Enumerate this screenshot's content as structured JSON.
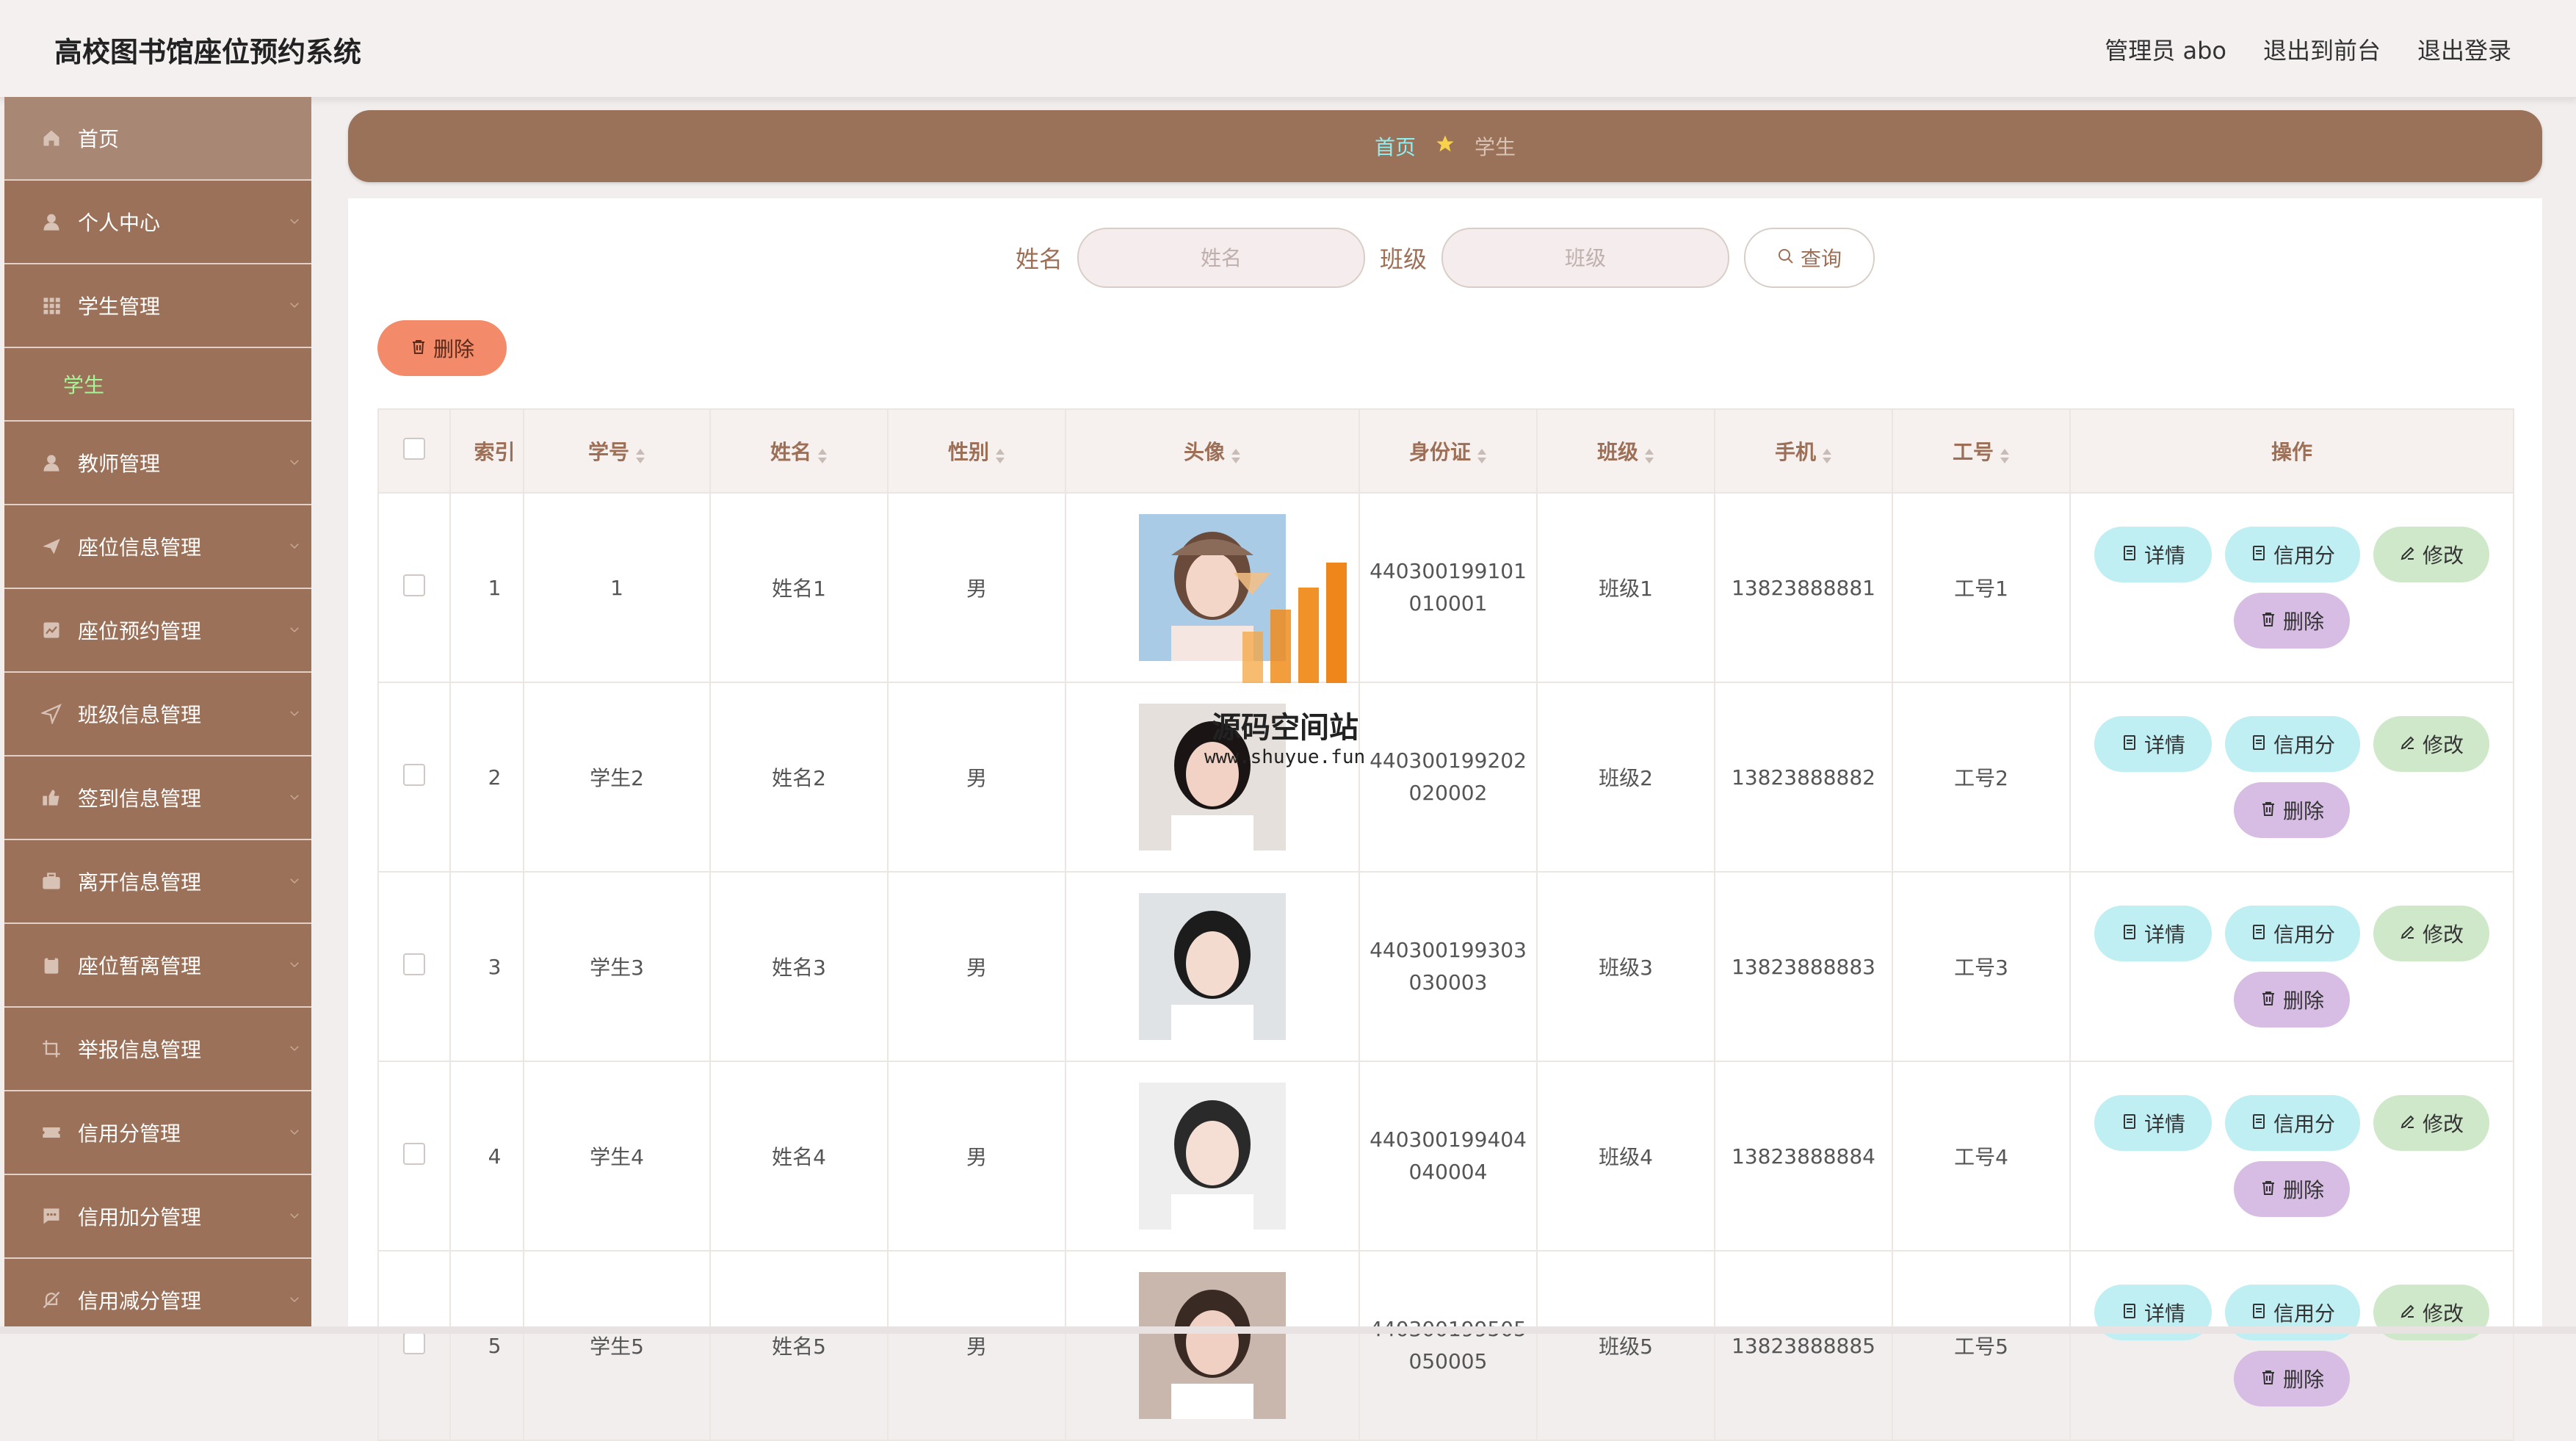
{
  "header": {
    "title": "高校图书馆座位预约系统",
    "admin": "管理员 abo",
    "exit_front": "退出到前台",
    "logout": "退出登录"
  },
  "sidebar": {
    "items": [
      {
        "label": "首页",
        "icon": "home-icon"
      },
      {
        "label": "个人中心",
        "icon": "user-icon"
      },
      {
        "label": "学生管理",
        "icon": "grid-icon",
        "sub": "学生"
      },
      {
        "label": "教师管理",
        "icon": "user-icon"
      },
      {
        "label": "座位信息管理",
        "icon": "send-icon"
      },
      {
        "label": "座位预约管理",
        "icon": "chart-icon"
      },
      {
        "label": "班级信息管理",
        "icon": "paper-plane-icon"
      },
      {
        "label": "签到信息管理",
        "icon": "thumb-icon"
      },
      {
        "label": "离开信息管理",
        "icon": "suitcase-icon"
      },
      {
        "label": "座位暂离管理",
        "icon": "clipboard-icon"
      },
      {
        "label": "举报信息管理",
        "icon": "crop-icon"
      },
      {
        "label": "信用分管理",
        "icon": "ticket-icon"
      },
      {
        "label": "信用加分管理",
        "icon": "message-icon"
      },
      {
        "label": "信用减分管理",
        "icon": "bell-off-icon"
      }
    ]
  },
  "breadcrumb": {
    "home": "首页",
    "current": "学生"
  },
  "search": {
    "name_label": "姓名",
    "name_placeholder": "姓名",
    "class_label": "班级",
    "class_placeholder": "班级",
    "query": "查询"
  },
  "actions": {
    "delete": "删除"
  },
  "table": {
    "headers": [
      "索引",
      "学号",
      "姓名",
      "性别",
      "头像",
      "身份证",
      "班级",
      "手机",
      "工号",
      "操作"
    ],
    "rows": [
      {
        "index": "1",
        "student_no": "1",
        "name": "姓名1",
        "gender": "男",
        "id_a": "440300199101",
        "id_b": "010001",
        "class": "班级1",
        "phone": "13823888881",
        "job_no": "工号1"
      },
      {
        "index": "2",
        "student_no": "学生2",
        "name": "姓名2",
        "gender": "男",
        "id_a": "440300199202",
        "id_b": "020002",
        "class": "班级2",
        "phone": "13823888882",
        "job_no": "工号2"
      },
      {
        "index": "3",
        "student_no": "学生3",
        "name": "姓名3",
        "gender": "男",
        "id_a": "440300199303",
        "id_b": "030003",
        "class": "班级3",
        "phone": "13823888883",
        "job_no": "工号3"
      },
      {
        "index": "4",
        "student_no": "学生4",
        "name": "姓名4",
        "gender": "男",
        "id_a": "440300199404",
        "id_b": "040004",
        "class": "班级4",
        "phone": "13823888884",
        "job_no": "工号4"
      },
      {
        "index": "5",
        "student_no": "学生5",
        "name": "姓名5",
        "gender": "男",
        "id_a": "440300199505",
        "id_b": "050005",
        "class": "班级5",
        "phone": "13823888885",
        "job_no": "工号5"
      }
    ],
    "ops": {
      "detail": "详情",
      "credit": "信用分",
      "edit": "修改",
      "delete": "删除"
    }
  },
  "watermark": {
    "title": "源码空间站",
    "url": "www.shuyue.fun"
  },
  "colors": {
    "sidebar": "#9c7159",
    "accent": "#9a7159",
    "link": "#8ff0f2",
    "active_sub": "#a7f598"
  }
}
